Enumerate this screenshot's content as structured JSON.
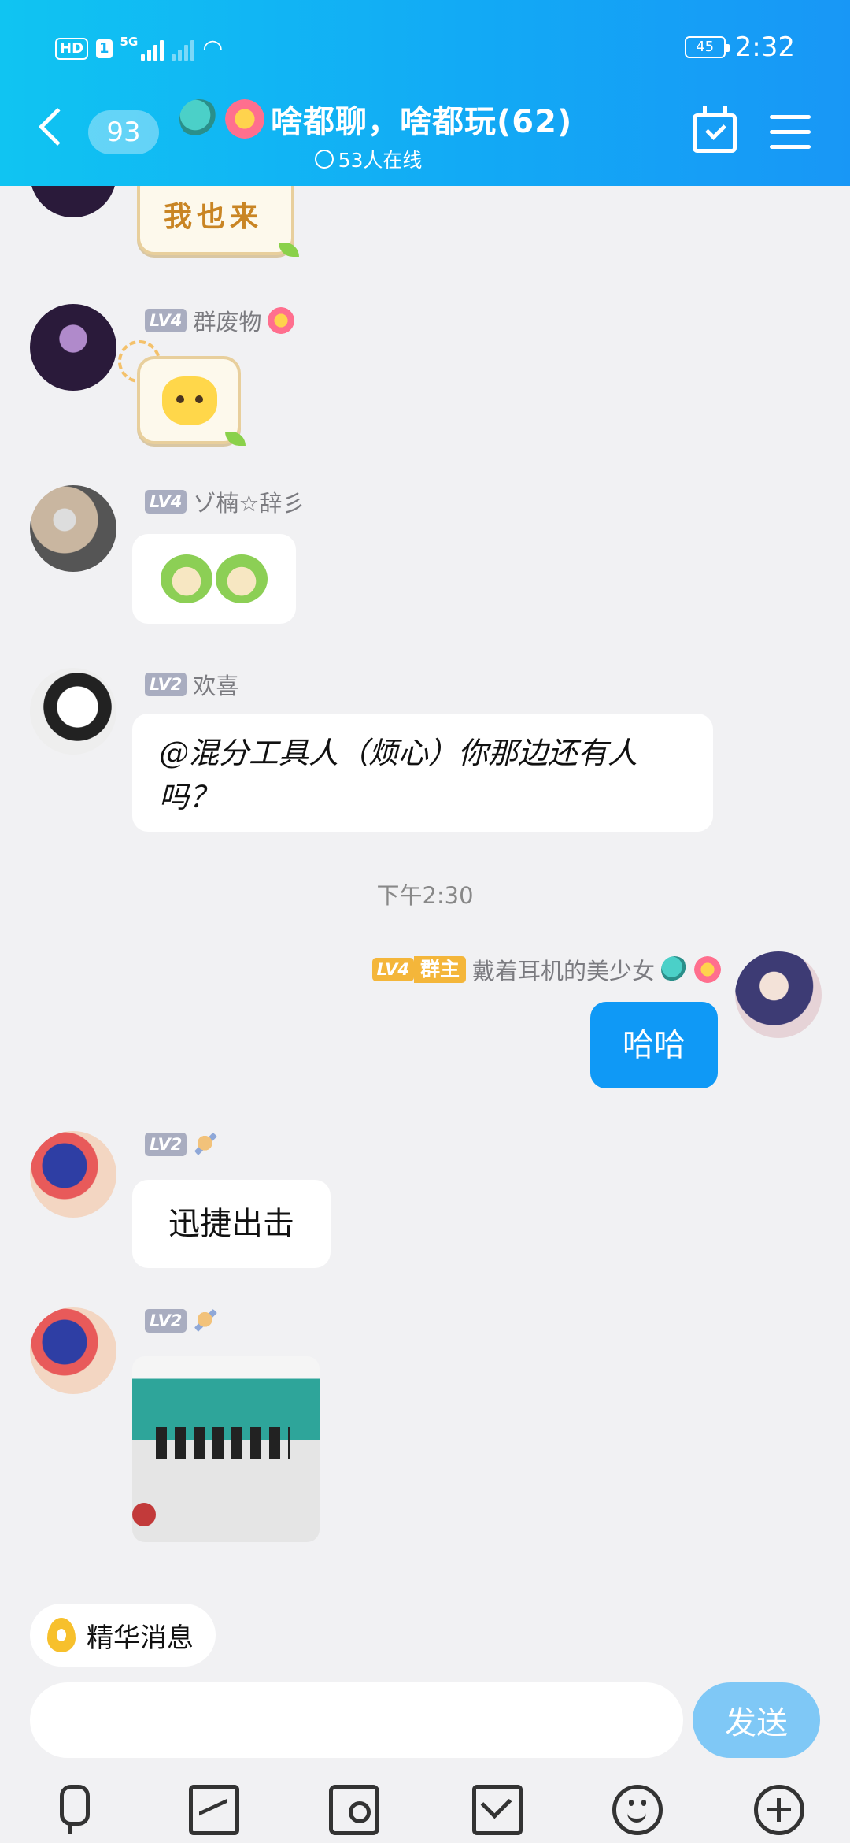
{
  "status_bar": {
    "hd": "HD",
    "sim": "1",
    "net": "5G",
    "battery": "45",
    "time": "2:32"
  },
  "header": {
    "unread_count": "93",
    "title": "啥都聊，啥都玩(62)",
    "online": "53人在线",
    "icons": [
      "back-icon",
      "calendar-check-icon",
      "menu-icon"
    ]
  },
  "messages": [
    {
      "sticker_text": "我也来"
    },
    {
      "level": "LV4",
      "name": "群废物",
      "content_type": "sticker"
    },
    {
      "level": "LV4",
      "name": "ゾ楠☆辞彡",
      "content_type": "sticker"
    },
    {
      "level": "LV2",
      "name": "欢喜",
      "text": "@混分工具人（烦心）你那边还有人吗？"
    },
    {
      "level": "LV4",
      "role": "群主",
      "name": "戴着耳机的美少女",
      "text": "哈哈",
      "self": true
    },
    {
      "level": "LV2",
      "text": "迅捷出击"
    },
    {
      "level": "LV2",
      "content_type": "image"
    }
  ],
  "timestamp": "下午2:30",
  "bottom": {
    "digest_label": "精华消息",
    "input_value": "",
    "input_placeholder": "",
    "send_label": "发送",
    "toolbar_icons": [
      "microphone-icon",
      "image-icon",
      "camera-icon",
      "red-packet-icon",
      "emoji-icon",
      "plus-icon"
    ]
  },
  "colors": {
    "header_start": "#10c4f2",
    "header_end": "#1897f6",
    "self_bubble": "#0f99f6",
    "send_button": "#7fc8f6",
    "owner_badge": "#f4b63a"
  }
}
